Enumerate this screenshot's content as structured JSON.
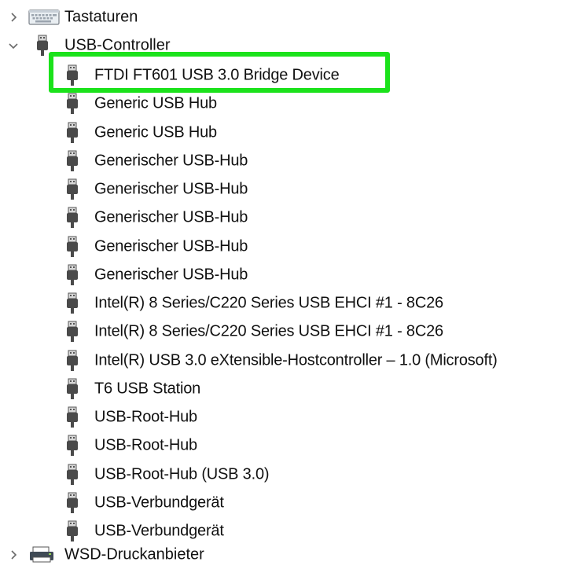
{
  "device_manager_tree": {
    "categories": {
      "keyboards": {
        "label": "Tastaturen",
        "icon": "keyboard-icon",
        "expanded": false
      },
      "usb_controllers": {
        "label": "USB-Controller",
        "icon": "usb-plug-icon",
        "expanded": true
      },
      "wsd_print": {
        "label": "WSD-Druckanbieter",
        "icon": "printer-icon",
        "expanded": false
      }
    },
    "usb_devices": [
      {
        "label": "FTDI FT601 USB 3.0 Bridge Device",
        "icon": "usb-plug-icon",
        "highlighted": true
      },
      {
        "label": "Generic USB Hub",
        "icon": "usb-plug-icon"
      },
      {
        "label": "Generic USB Hub",
        "icon": "usb-plug-icon"
      },
      {
        "label": "Generischer USB-Hub",
        "icon": "usb-plug-icon"
      },
      {
        "label": "Generischer USB-Hub",
        "icon": "usb-plug-icon"
      },
      {
        "label": "Generischer USB-Hub",
        "icon": "usb-plug-icon"
      },
      {
        "label": "Generischer USB-Hub",
        "icon": "usb-plug-icon"
      },
      {
        "label": "Generischer USB-Hub",
        "icon": "usb-plug-icon"
      },
      {
        "label": "Intel(R) 8 Series/C220 Series USB EHCI #1 - 8C26",
        "icon": "usb-plug-icon"
      },
      {
        "label": "Intel(R) 8 Series/C220 Series USB EHCI #1 - 8C26",
        "icon": "usb-plug-icon"
      },
      {
        "label": "Intel(R) USB 3.0 eXtensible-Hostcontroller – 1.0 (Microsoft)",
        "icon": "usb-plug-icon"
      },
      {
        "label": "T6 USB Station",
        "icon": "usb-plug-icon"
      },
      {
        "label": "USB-Root-Hub",
        "icon": "usb-plug-icon"
      },
      {
        "label": "USB-Root-Hub",
        "icon": "usb-plug-icon"
      },
      {
        "label": "USB-Root-Hub (USB 3.0)",
        "icon": "usb-plug-icon"
      },
      {
        "label": "USB-Verbundgerät",
        "icon": "usb-plug-icon"
      },
      {
        "label": "USB-Verbundgerät",
        "icon": "usb-plug-icon"
      }
    ],
    "highlight_color": "#1be21b",
    "text_color": "#111111"
  }
}
